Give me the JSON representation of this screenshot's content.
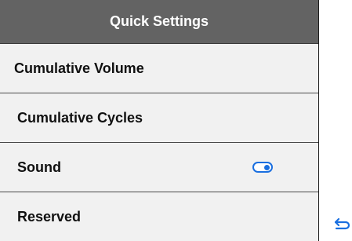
{
  "header": {
    "title": "Quick Settings"
  },
  "items": [
    {
      "label": "Cumulative Volume"
    },
    {
      "label": "Cumulative Cycles"
    },
    {
      "label": "Sound",
      "toggle_state": "on"
    },
    {
      "label": "Reserved"
    }
  ],
  "colors": {
    "header_bg": "#636363",
    "toggle_accent": "#1a6fe0",
    "row_bg": "#f1f1f1"
  },
  "icons": {
    "sound_toggle": "toggle-switch-icon",
    "back": "back-arrow-icon"
  }
}
